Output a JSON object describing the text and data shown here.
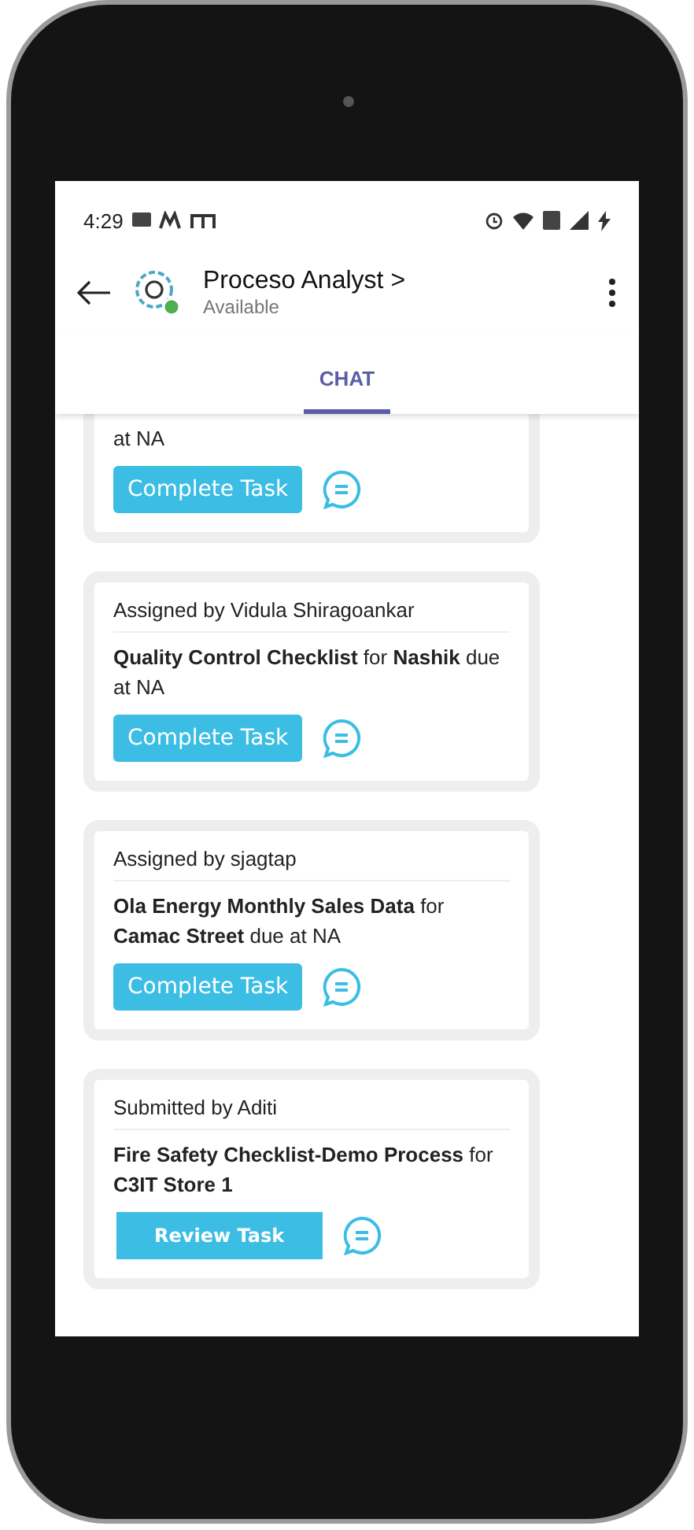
{
  "status_bar": {
    "time": "4:29"
  },
  "header": {
    "title": "Proceso Analyst",
    "chevron": ">",
    "subtitle": "Available"
  },
  "tabs": [
    {
      "label": "CHAT",
      "selected": true
    }
  ],
  "cards": [
    {
      "body": "at NA",
      "button": {
        "kind": "complete",
        "label": "Complete Task"
      }
    },
    {
      "sender": "Assigned by Vidula Shiragoankar",
      "body": "**Quality Control Checklist** for **Nashik** due at NA",
      "button": {
        "kind": "complete",
        "label": "Complete Task"
      }
    },
    {
      "sender": "Assigned by sjagtap",
      "body": "**Ola Energy Monthly Sales Data** for **Camac Street** due at NA",
      "button": {
        "kind": "complete",
        "label": "Complete Task"
      }
    },
    {
      "sender": "Submitted by Aditi",
      "body": "**Fire Safety Checklist-Demo Process** for **C3IT Store 1**",
      "button": {
        "kind": "review",
        "label": "Review Task"
      }
    }
  ]
}
